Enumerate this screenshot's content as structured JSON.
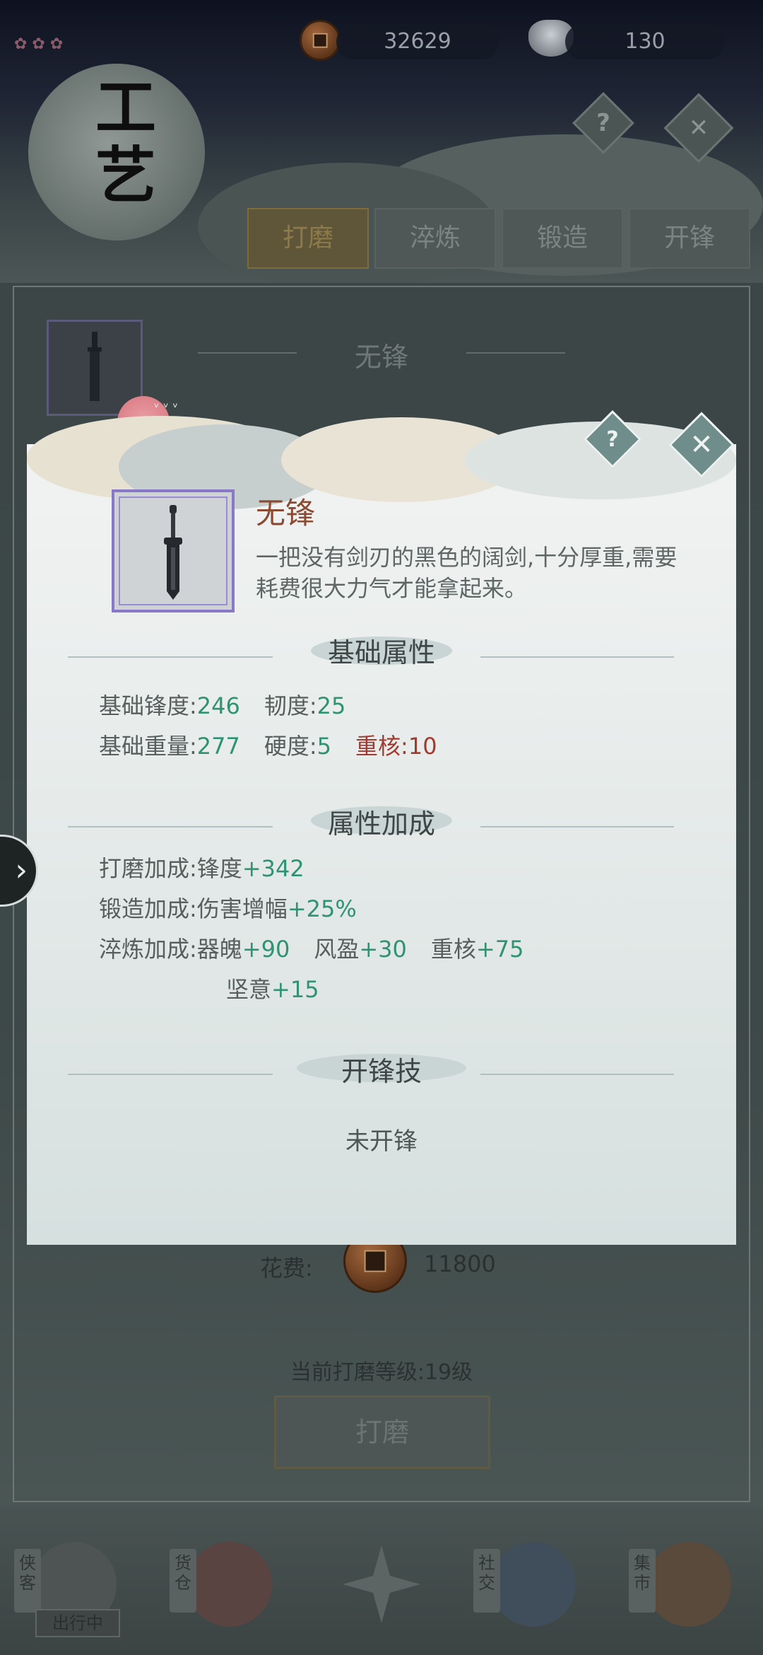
{
  "currency": {
    "coins": "32629",
    "silver": "130"
  },
  "header": {
    "title_line1": "工",
    "title_line2": "艺",
    "help_icon": "question-icon",
    "close_icon": "close-icon"
  },
  "tabs": [
    {
      "label": "打磨",
      "active": true
    },
    {
      "label": "淬炼",
      "active": false
    },
    {
      "label": "锻造",
      "active": false
    },
    {
      "label": "开锋",
      "active": false
    }
  ],
  "behind": {
    "item_title": "无锋",
    "cost_label": "花费:",
    "cost_value": "11800",
    "level_text": "当前打磨等级:19级",
    "polish_button": "打磨"
  },
  "modal": {
    "help_glyph": "?",
    "close_glyph": "✕",
    "item_name": "无锋",
    "item_desc": "一把没有剑刃的黑色的阔剑,十分厚重,需要耗费很大力气才能拿起来。",
    "base_section": "基础属性",
    "base_rows": [
      [
        {
          "label": "基础锋度:",
          "value": "246"
        },
        {
          "label": "韧度:",
          "value": "25"
        }
      ],
      [
        {
          "label": "基础重量:",
          "value": "277"
        },
        {
          "label": "硬度:",
          "value": "5"
        },
        {
          "label": "重核:",
          "value": "10"
        }
      ]
    ],
    "bonus_section": "属性加成",
    "bonus": {
      "polish_label": "打磨加成:",
      "polish_stat": "锋度",
      "polish_value": "+342",
      "forge_label": "锻造加成:",
      "forge_stat": "伤害增幅",
      "forge_value": "+25%",
      "temper_label": "淬炼加成:",
      "temper_items": [
        {
          "stat": "器魄",
          "value": "+90"
        },
        {
          "stat": "风盈",
          "value": "+30"
        },
        {
          "stat": "重核",
          "value": "+75"
        },
        {
          "stat": "坚意",
          "value": "+15"
        }
      ]
    },
    "skill_section": "开锋技",
    "skill_status": "未开锋"
  },
  "bottom_nav": [
    {
      "label": "侠客",
      "status": "出行中"
    },
    {
      "label": "货仓"
    },
    {
      "label": ""
    },
    {
      "label": "社交"
    },
    {
      "label": "集市"
    }
  ],
  "side_arrow": "›",
  "colors": {
    "item_name": "#8b4b33",
    "positive_value": "#2f9272",
    "heavy_core": "#a23a30",
    "item_frame": "#8878c7"
  }
}
